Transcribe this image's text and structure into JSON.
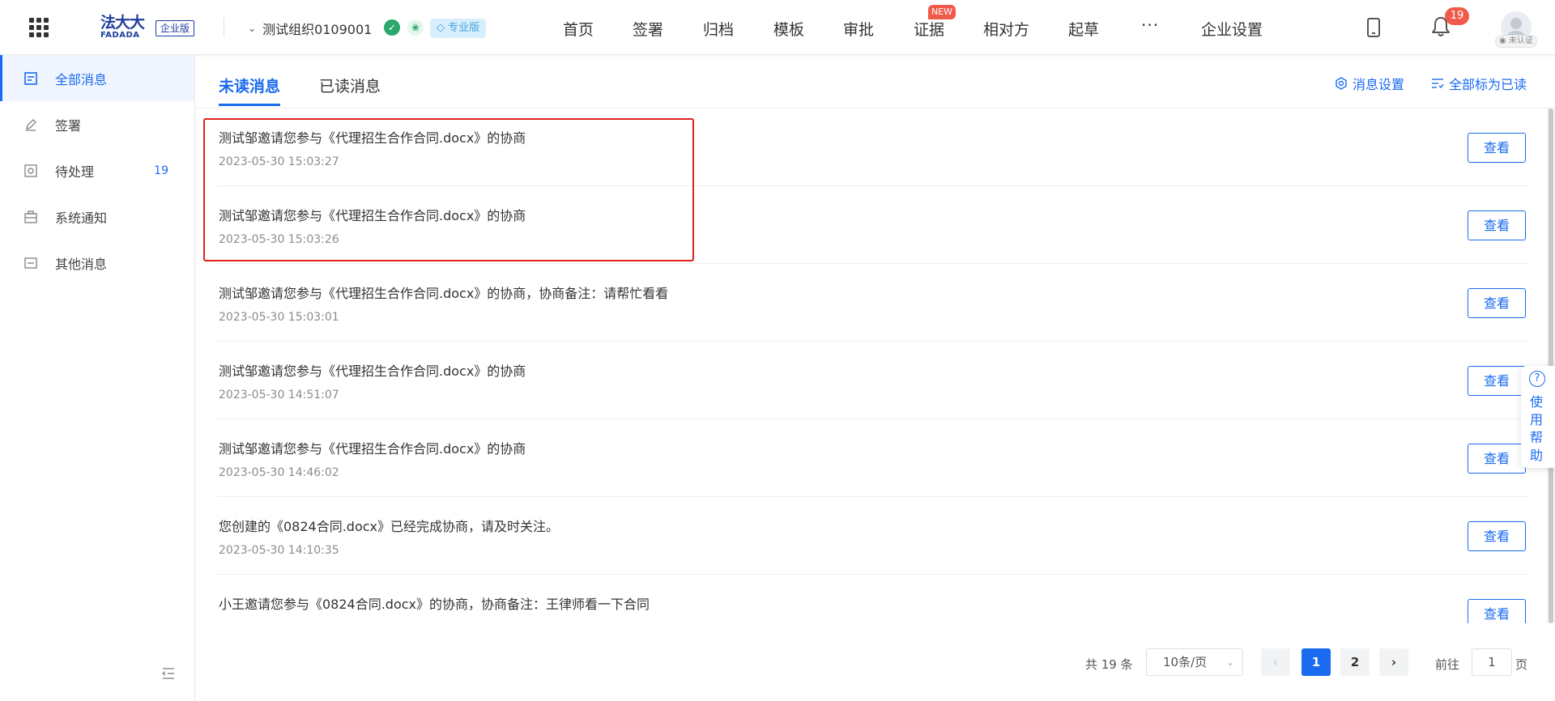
{
  "header": {
    "logo_cn": "法大大",
    "logo_en": "FADADA",
    "edition": "企业版",
    "org_name": "测试组织0109001",
    "plan_badge": "专业版",
    "nav": [
      "首页",
      "签署",
      "归档",
      "模板",
      "审批",
      "证据",
      "相对方",
      "起草",
      "企业设置"
    ],
    "new_badge": "NEW",
    "more": "···",
    "notification_count": "19",
    "auth_status": "未认证"
  },
  "sidebar": {
    "items": [
      {
        "label": "全部消息",
        "icon": "message-icon"
      },
      {
        "label": "签署",
        "icon": "pen-icon"
      },
      {
        "label": "待处理",
        "icon": "pending-icon",
        "count": "19"
      },
      {
        "label": "系统通知",
        "icon": "briefcase-icon"
      },
      {
        "label": "其他消息",
        "icon": "other-icon"
      }
    ]
  },
  "tabs": {
    "unread": "未读消息",
    "read": "已读消息",
    "settings": "消息设置",
    "mark_all": "全部标为已读"
  },
  "messages": [
    {
      "text": "测试邹邀请您参与《代理招生合作合同.docx》的协商",
      "time": "2023-05-30 15:03:27"
    },
    {
      "text": "测试邹邀请您参与《代理招生合作合同.docx》的协商",
      "time": "2023-05-30 15:03:26"
    },
    {
      "text": "测试邹邀请您参与《代理招生合作合同.docx》的协商，协商备注：请帮忙看看",
      "time": "2023-05-30 15:03:01"
    },
    {
      "text": "测试邹邀请您参与《代理招生合作合同.docx》的协商",
      "time": "2023-05-30 14:51:07"
    },
    {
      "text": "测试邹邀请您参与《代理招生合作合同.docx》的协商",
      "time": "2023-05-30 14:46:02"
    },
    {
      "text": "您创建的《0824合同.docx》已经完成协商，请及时关注。",
      "time": "2023-05-30 14:10:35"
    },
    {
      "text": "小王邀请您参与《0824合同.docx》的协商，协商备注：王律师看一下合同",
      "time": ""
    }
  ],
  "view_label": "查看",
  "help": {
    "icon": "?",
    "label": "使用帮助"
  },
  "pagination": {
    "total": "共 19 条",
    "page_size": "10条/页",
    "prev": "‹",
    "next": "›",
    "pages": [
      "1",
      "2"
    ],
    "current": "1",
    "goto_label": "前往",
    "goto_value": "1",
    "goto_suffix": "页"
  },
  "colors": {
    "accent": "#1a6bf0",
    "highlight": "#e0201c",
    "badge": "#f05a4a"
  }
}
